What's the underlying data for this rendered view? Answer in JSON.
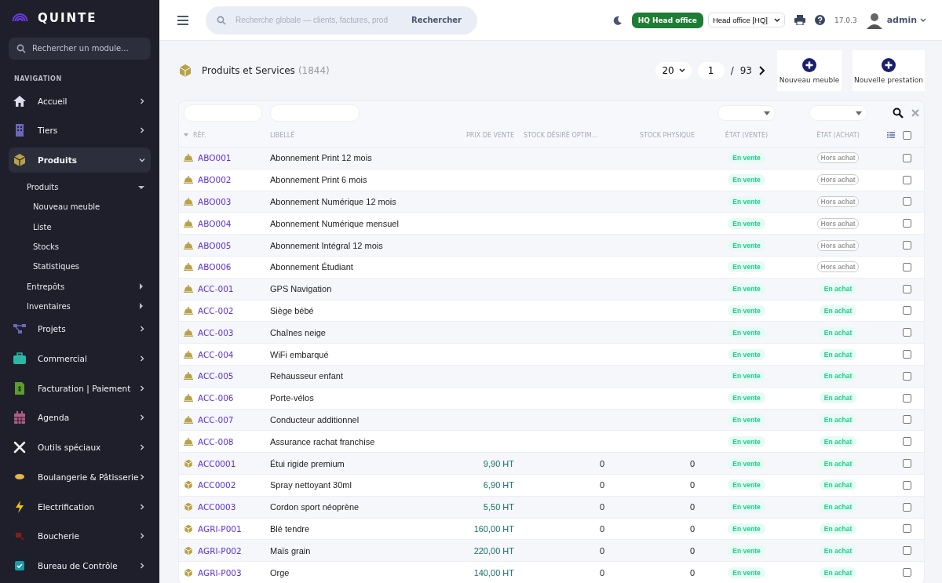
{
  "brand": "QUINTE",
  "sidebar": {
    "search": {
      "placeholder": "Rechercher un module..."
    },
    "section": "NAVIGATION",
    "items": [
      {
        "label": "Accueil",
        "expanded": false,
        "selected": false
      },
      {
        "label": "Tiers",
        "expanded": false,
        "selected": false
      },
      {
        "label": "Produits",
        "expanded": true,
        "selected": true,
        "children": [
          {
            "label": "Produits",
            "expanded": true,
            "children": [
              {
                "label": "Nouveau meuble"
              },
              {
                "label": "Liste"
              },
              {
                "label": "Stocks"
              },
              {
                "label": "Statistiques"
              }
            ]
          },
          {
            "label": "Entrepôts",
            "expanded": false
          },
          {
            "label": "Inventaires",
            "expanded": false
          }
        ]
      },
      {
        "label": "Projets",
        "expanded": false,
        "selected": false
      },
      {
        "label": "Commercial",
        "expanded": false,
        "selected": false
      },
      {
        "label": "Facturation | Paiement",
        "expanded": false,
        "selected": false
      },
      {
        "label": "Agenda",
        "expanded": false,
        "selected": false
      },
      {
        "label": "Outils spéciaux",
        "expanded": false,
        "selected": false
      },
      {
        "label": "Boulangerie & Pâtisserie",
        "expanded": false,
        "selected": false
      },
      {
        "label": "Electrification",
        "expanded": false,
        "selected": false
      },
      {
        "label": "Boucherie",
        "expanded": false,
        "selected": false
      },
      {
        "label": "Bureau de Contrôle",
        "expanded": false,
        "selected": false
      }
    ]
  },
  "topbar": {
    "search": {
      "placeholder": "Recherche globale — clients, factures, prod",
      "button": "Rechercher"
    },
    "entity_badge": "HQ Head office",
    "entity_select": "Head office [HQ]",
    "version": "17.0.3",
    "user": "admin"
  },
  "page": {
    "title": "Produits et Services",
    "count": "(1844)",
    "per_page": "20",
    "page": "1",
    "separator": "/",
    "total_pages": "93",
    "actions": [
      "Nouveau meuble",
      "Nouvelle prestation"
    ]
  },
  "table": {
    "select_all_checked": false,
    "columns": [
      "RÉF.",
      "LIBELLÉ",
      "PRIX DE VENTE",
      "STOCK DÉSIRÉ OPTIM…",
      "STOCK PHYSIQUE",
      "ÉTAT (VENTE)",
      "ÉTAT (ACHAT)"
    ],
    "rows": [
      {
        "kind": "service",
        "ref": "ABO001",
        "label": "Abonnement Print 12 mois",
        "price": "",
        "stock_desired": "",
        "stock": "",
        "sell": "En vente",
        "buy": "Hors achat",
        "buy_on": false,
        "checked": false
      },
      {
        "kind": "service",
        "ref": "ABO002",
        "label": "Abonnement Print 6 mois",
        "price": "",
        "stock_desired": "",
        "stock": "",
        "sell": "En vente",
        "buy": "Hors achat",
        "buy_on": false,
        "checked": false
      },
      {
        "kind": "service",
        "ref": "ABO003",
        "label": "Abonnement Numérique 12 mois",
        "price": "",
        "stock_desired": "",
        "stock": "",
        "sell": "En vente",
        "buy": "Hors achat",
        "buy_on": false,
        "checked": false
      },
      {
        "kind": "service",
        "ref": "ABO004",
        "label": "Abonnement Numérique mensuel",
        "price": "",
        "stock_desired": "",
        "stock": "",
        "sell": "En vente",
        "buy": "Hors achat",
        "buy_on": false,
        "checked": false
      },
      {
        "kind": "service",
        "ref": "ABO005",
        "label": "Abonnement Intégral 12 mois",
        "price": "",
        "stock_desired": "",
        "stock": "",
        "sell": "En vente",
        "buy": "Hors achat",
        "buy_on": false,
        "checked": false
      },
      {
        "kind": "service",
        "ref": "ABO006",
        "label": "Abonnement Étudiant",
        "price": "",
        "stock_desired": "",
        "stock": "",
        "sell": "En vente",
        "buy": "Hors achat",
        "buy_on": false,
        "checked": false
      },
      {
        "kind": "service",
        "ref": "ACC-001",
        "label": "GPS Navigation",
        "price": "",
        "stock_desired": "",
        "stock": "",
        "sell": "En vente",
        "buy": "En achat",
        "buy_on": true,
        "checked": false
      },
      {
        "kind": "service",
        "ref": "ACC-002",
        "label": "Siège bébé",
        "price": "",
        "stock_desired": "",
        "stock": "",
        "sell": "En vente",
        "buy": "En achat",
        "buy_on": true,
        "checked": false
      },
      {
        "kind": "service",
        "ref": "ACC-003",
        "label": "Chaînes neige",
        "price": "",
        "stock_desired": "",
        "stock": "",
        "sell": "En vente",
        "buy": "En achat",
        "buy_on": true,
        "checked": false
      },
      {
        "kind": "service",
        "ref": "ACC-004",
        "label": "WiFi embarqué",
        "price": "",
        "stock_desired": "",
        "stock": "",
        "sell": "En vente",
        "buy": "En achat",
        "buy_on": true,
        "checked": false
      },
      {
        "kind": "service",
        "ref": "ACC-005",
        "label": "Rehausseur enfant",
        "price": "",
        "stock_desired": "",
        "stock": "",
        "sell": "En vente",
        "buy": "En achat",
        "buy_on": true,
        "checked": false
      },
      {
        "kind": "service",
        "ref": "ACC-006",
        "label": "Porte-vélos",
        "price": "",
        "stock_desired": "",
        "stock": "",
        "sell": "En vente",
        "buy": "En achat",
        "buy_on": true,
        "checked": false
      },
      {
        "kind": "service",
        "ref": "ACC-007",
        "label": "Conducteur additionnel",
        "price": "",
        "stock_desired": "",
        "stock": "",
        "sell": "En vente",
        "buy": "En achat",
        "buy_on": true,
        "checked": false
      },
      {
        "kind": "service",
        "ref": "ACC-008",
        "label": "Assurance rachat franchise",
        "price": "",
        "stock_desired": "",
        "stock": "",
        "sell": "En vente",
        "buy": "En achat",
        "buy_on": true,
        "checked": false
      },
      {
        "kind": "product",
        "ref": "ACC0001",
        "label": "Étui rigide premium",
        "price": "9,90 HT",
        "stock_desired": "0",
        "stock": "0",
        "sell": "En vente",
        "buy": "En achat",
        "buy_on": true,
        "checked": false
      },
      {
        "kind": "product",
        "ref": "ACC0002",
        "label": "Spray nettoyant 30ml",
        "price": "6,90 HT",
        "stock_desired": "0",
        "stock": "0",
        "sell": "En vente",
        "buy": "En achat",
        "buy_on": true,
        "checked": false
      },
      {
        "kind": "product",
        "ref": "ACC0003",
        "label": "Cordon sport néoprène",
        "price": "5,50 HT",
        "stock_desired": "0",
        "stock": "0",
        "sell": "En vente",
        "buy": "En achat",
        "buy_on": true,
        "checked": false
      },
      {
        "kind": "product",
        "ref": "AGRI-P001",
        "label": "Blé tendre",
        "price": "160,00 HT",
        "stock_desired": "0",
        "stock": "0",
        "sell": "En vente",
        "buy": "En achat",
        "buy_on": true,
        "checked": false
      },
      {
        "kind": "product",
        "ref": "AGRI-P002",
        "label": "Maïs grain",
        "price": "220,00 HT",
        "stock_desired": "0",
        "stock": "0",
        "sell": "En vente",
        "buy": "En achat",
        "buy_on": true,
        "checked": false
      },
      {
        "kind": "product",
        "ref": "AGRI-P003",
        "label": "Orge",
        "price": "140,00 HT",
        "stock_desired": "0",
        "stock": "0",
        "sell": "En vente",
        "buy": "En achat",
        "buy_on": true,
        "checked": false
      }
    ]
  }
}
